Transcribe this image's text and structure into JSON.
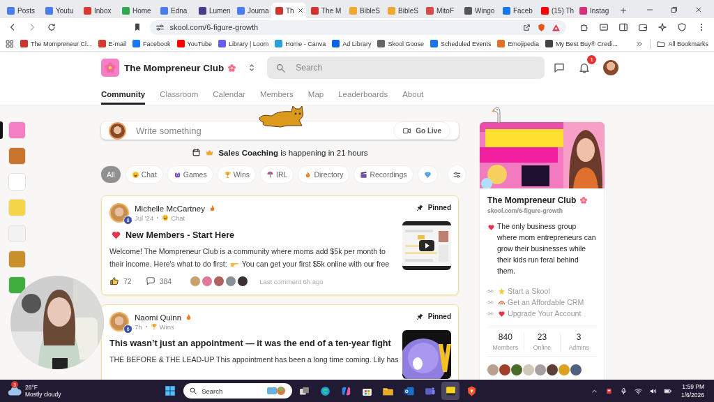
{
  "browser": {
    "tabs": [
      {
        "label": "Posts",
        "color": "#4a7cf0",
        "selected": false
      },
      {
        "label": "Youtu",
        "color": "#4a7cf0",
        "selected": false
      },
      {
        "label": "Inbox",
        "color": "#d93a2f",
        "selected": false
      },
      {
        "label": "Home",
        "color": "#2fa84f",
        "selected": false
      },
      {
        "label": "Edna",
        "color": "#4a7cf0",
        "selected": false
      },
      {
        "label": "Lumen",
        "color": "#4b3a8c",
        "selected": false
      },
      {
        "label": "Journa",
        "color": "#4a7cf0",
        "selected": false
      },
      {
        "label": "Th",
        "color": "#d0342c",
        "selected": true
      },
      {
        "label": "The M",
        "color": "#d0342c",
        "selected": false
      },
      {
        "label": "BibleS",
        "color": "#f0a830",
        "selected": false
      },
      {
        "label": "BibleS",
        "color": "#f0a830",
        "selected": false
      },
      {
        "label": "MitoF",
        "color": "#d94a4a",
        "selected": false
      },
      {
        "label": "Wingo",
        "color": "#555555",
        "selected": false
      },
      {
        "label": "Faceb",
        "color": "#1877f2",
        "selected": false
      },
      {
        "label": "(15) Th",
        "color": "#ff0000",
        "selected": false
      },
      {
        "label": "Instag",
        "color": "#d6307a",
        "selected": false
      }
    ],
    "address": "skool.com/6-figure-growth",
    "bookmarks": [
      {
        "label": "The Mompreneur Cl...",
        "color": "#d0342c"
      },
      {
        "label": "E-mail",
        "color": "#d93a2f"
      },
      {
        "label": "Facebook",
        "color": "#1877f2"
      },
      {
        "label": "YouTube",
        "color": "#ff0000"
      },
      {
        "label": "Library | Loom",
        "color": "#625df5"
      },
      {
        "label": "Home - Canva",
        "color": "#2b9fd8"
      },
      {
        "label": "Ad Library",
        "color": "#0a66e0"
      },
      {
        "label": "Skool Goose",
        "color": "#666666"
      },
      {
        "label": "Scheduled Events",
        "color": "#1a73e8"
      },
      {
        "label": "Emojipedia",
        "color": "#e0702a"
      },
      {
        "label": "My Best Buy® Credi...",
        "color": "#444444"
      }
    ],
    "all_bookmarks": "All Bookmarks"
  },
  "header": {
    "group_name": "The Mompreneur Club",
    "search": {
      "placeholder": "Search"
    },
    "notifications": "1"
  },
  "nav": [
    {
      "label": "Community",
      "selected": true
    },
    {
      "label": "Classroom",
      "selected": false
    },
    {
      "label": "Calendar",
      "selected": false
    },
    {
      "label": "Members",
      "selected": false
    },
    {
      "label": "Map",
      "selected": false
    },
    {
      "label": "Leaderboards",
      "selected": false
    },
    {
      "label": "About",
      "selected": false
    }
  ],
  "groups": [
    {
      "color": "#f47fc4",
      "selected": true
    },
    {
      "color": "#c9742e",
      "selected": false
    },
    {
      "color": "#ffffff",
      "selected": false
    },
    {
      "color": "#f5d64a",
      "selected": false
    },
    {
      "color": "#f2f2f2",
      "selected": false
    },
    {
      "color": "#c8902a",
      "selected": false
    },
    {
      "color": "#3fae3f",
      "selected": false
    }
  ],
  "composer": {
    "placeholder": "Write something",
    "button": "Go Live"
  },
  "event": {
    "name": "Sales Coaching",
    "text": "is happening in 21 hours"
  },
  "filters": [
    {
      "label": "All",
      "selected": true
    },
    {
      "label": "Chat",
      "kind": "laugh",
      "selected": false
    },
    {
      "label": "Games",
      "kind": "alien",
      "selected": false
    },
    {
      "label": "Wins",
      "kind": "trophy",
      "selected": false
    },
    {
      "label": "IRL",
      "kind": "beach",
      "selected": false
    },
    {
      "label": "Directory",
      "kind": "fire",
      "selected": false
    },
    {
      "label": "Recordings",
      "kind": "clap",
      "selected": false
    },
    {
      "kind": "diamond",
      "selected": false
    }
  ],
  "posts": [
    {
      "author": "Michelle McCartney",
      "level": "8",
      "time": "Jul '24",
      "category": {
        "label": "Chat",
        "kind": "laugh"
      },
      "pinned": true,
      "pin_label": "Pinned",
      "title_icon": {
        "kind": "heart"
      },
      "title": "New Members - Start Here",
      "excerpt": [
        [
          "Welcome! The Mompreneur Club is a community where moms add $5k per month to"
        ],
        [
          "their income. Here's what to do first:",
          "You can get your first $5k online with our free"
        ]
      ],
      "likes": "72",
      "comments": "384",
      "commenters": [
        {
          "kind": "picture"
        },
        {
          "kind": "picture"
        },
        {
          "kind": "picture"
        },
        {
          "kind": "picture"
        },
        {
          "kind": "picture"
        }
      ],
      "last_comment": "Last comment 6h ago"
    },
    {
      "author": "Naomi Quinn",
      "level": "6",
      "time": "7h",
      "category": {
        "label": "Wins",
        "kind": "trophy"
      },
      "pinned": true,
      "pin_label": "Pinned",
      "title": "This wasn’t just an appointment — it was the end of a ten-year fight",
      "excerpt": [
        [
          "THE BEFORE & THE LEAD-UP This appointment has been a long time coming. Lily has"
        ]
      ]
    }
  ],
  "about": {
    "name": "The Mompreneur Club",
    "url": "skool.com/6-figure-growth",
    "description": "The only business group where mom entrepreneurs can grow their businesses while their kids run feral behind them.",
    "links": [
      {
        "label": "Start a Skool",
        "kind": "star"
      },
      {
        "label": "Get an Affordable CRM",
        "kind": "rainbow"
      },
      {
        "label": "Upgrade Your Account",
        "kind": "heart"
      }
    ],
    "stats": [
      {
        "value": "840",
        "label": "Members"
      },
      {
        "value": "23",
        "label": "Online"
      },
      {
        "value": "3",
        "label": "Admins"
      }
    ],
    "members": [
      {
        "kind": "picture"
      },
      {
        "kind": "picture"
      },
      {
        "kind": "picture"
      },
      {
        "kind": "picture"
      },
      {
        "kind": "picture"
      },
      {
        "kind": "picture"
      },
      {
        "kind": "picture"
      },
      {
        "kind": "picture"
      }
    ]
  },
  "taskbar": {
    "temperature": "28°F",
    "condition": "Mostly cloudy",
    "weather_badge": "3",
    "search": {
      "placeholder": "Search"
    },
    "apps": [
      {
        "kind": "taskview",
        "selected": false
      },
      {
        "kind": "edge",
        "selected": false
      },
      {
        "kind": "copilot",
        "selected": false
      },
      {
        "kind": "store",
        "selected": false
      },
      {
        "kind": "folder",
        "selected": false
      },
      {
        "kind": "outlook",
        "selected": false
      },
      {
        "kind": "teams",
        "selected": false
      },
      {
        "kind": "notes",
        "selected": true
      },
      {
        "kind": "brave",
        "selected": false
      }
    ],
    "time": "1:59 PM",
    "date": "1/6/2026"
  }
}
